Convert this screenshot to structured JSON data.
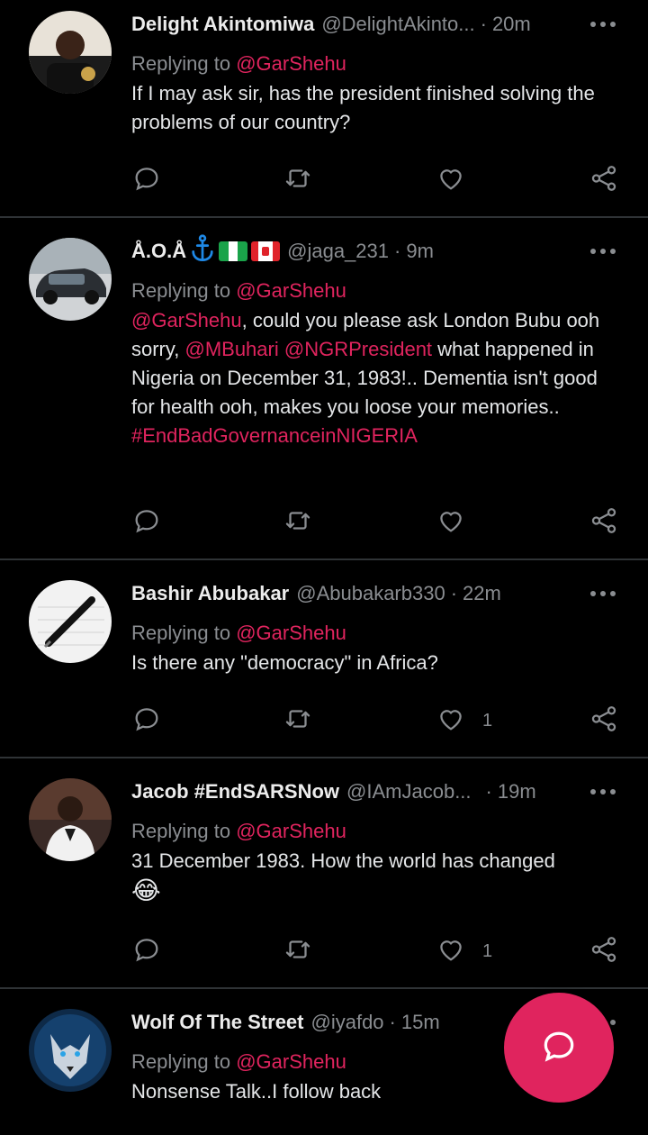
{
  "tweets": [
    {
      "name": "Delight Akintomiwa",
      "handle": "@DelightAkinto...",
      "time": "20m",
      "replying_prefix": "Replying to ",
      "replying_to": "@GarShehu",
      "body": "If I may ask sir, has the president finished solving the problems of our country?",
      "likes": ""
    },
    {
      "name": "Å.O.Å",
      "handle": "@jaga_231",
      "time": "9m",
      "replying_prefix": "Replying to ",
      "replying_to": "@GarShehu",
      "body_parts": {
        "m1": "@GarShehu",
        "t1": ", could you please ask London Bubu ooh sorry, ",
        "m2": "@MBuhari",
        "m3": "@NGRPresident",
        "t2": " what happened in Nigeria on December 31, 1983!.. Dementia isn't good for health ooh, makes you loose your memories..",
        "hashtag": "#EndBadGovernanceinNIGERIA"
      },
      "likes": ""
    },
    {
      "name": "Bashir Abubakar",
      "handle": "@Abubakarb330",
      "time": "22m",
      "replying_prefix": "Replying to ",
      "replying_to": "@GarShehu",
      "body": "Is there any \"democracy\" in Africa?",
      "likes": "1"
    },
    {
      "name": "Jacob #EndSARSNow",
      "handle": "@IAmJacob...",
      "time": "19m",
      "replying_prefix": "Replying to ",
      "replying_to": "@GarShehu",
      "body": "31 December 1983. How the world has changed",
      "emoji": "😂",
      "likes": "1"
    },
    {
      "name": "Wolf Of The Street",
      "handle": "@iyafdo",
      "time": "15m",
      "replying_prefix": "Replying to ",
      "replying_to": "@GarShehu",
      "body": "Nonsense Talk..I follow back",
      "likes": ""
    }
  ],
  "icons": {
    "reply": "reply-icon",
    "retweet": "retweet-icon",
    "like": "heart-icon",
    "share": "share-icon",
    "more": "more-icon",
    "compose": "compose-reply-icon"
  },
  "colors": {
    "background": "#000000",
    "accent": "#e0245e",
    "muted": "#8a8d91",
    "divider": "#2f3336"
  }
}
